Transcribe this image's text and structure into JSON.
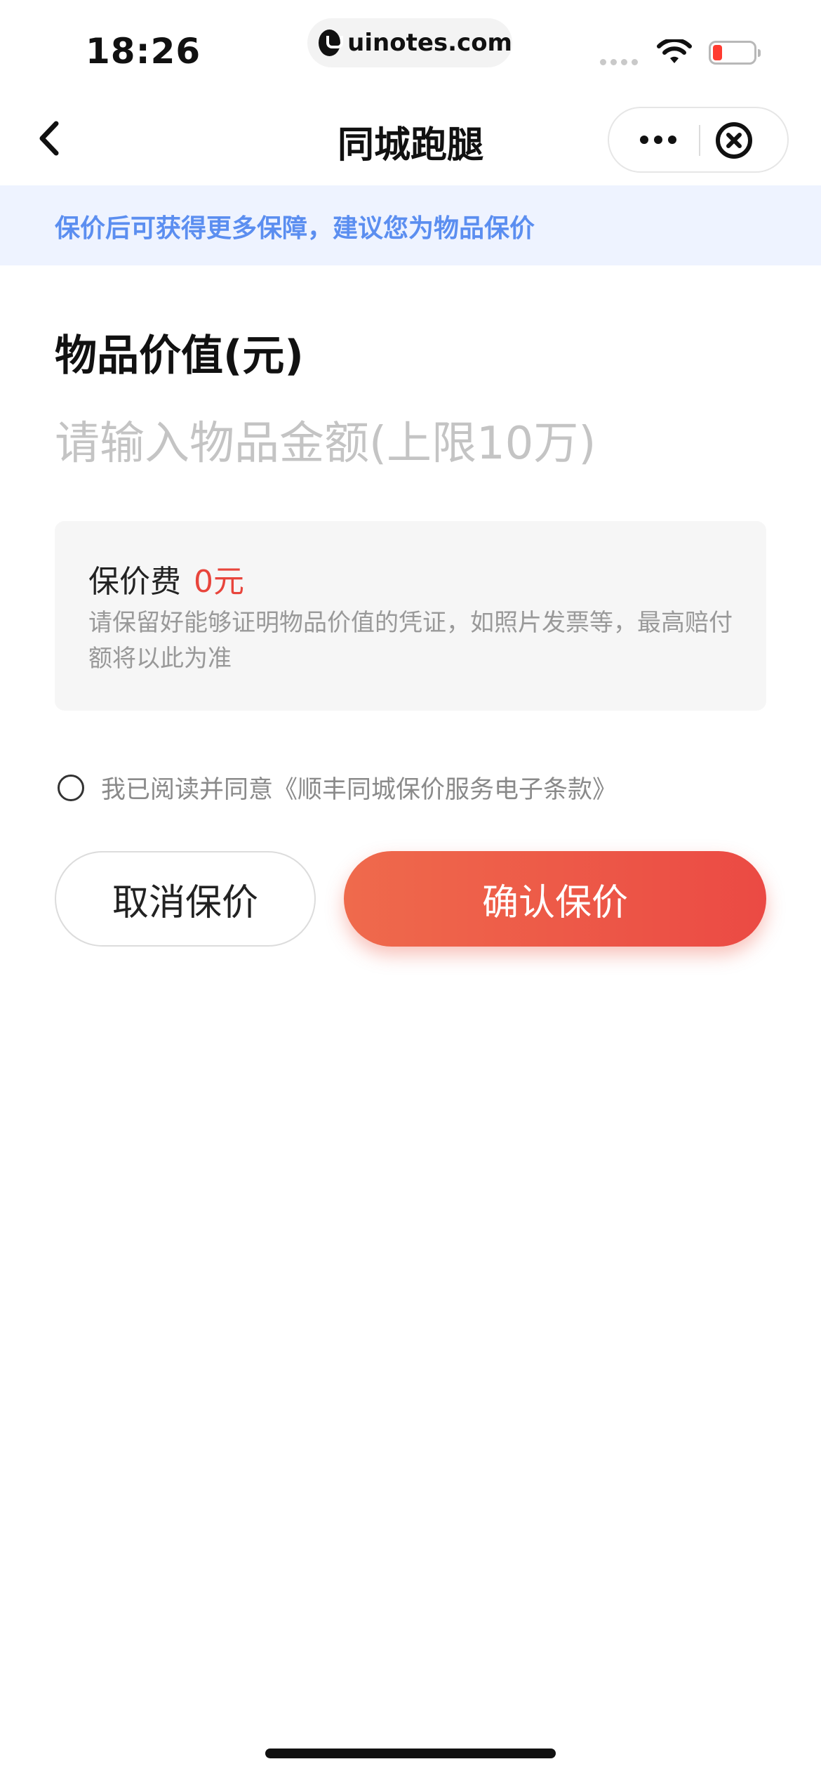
{
  "status_bar": {
    "time": "18:26",
    "url": "uinotes.com"
  },
  "nav": {
    "title": "同城跑腿",
    "back_icon": "chevron-left-icon",
    "more_icon": "more-dots-icon",
    "close_icon": "close-circle-icon"
  },
  "notice": {
    "text": "保价后可获得更多保障，建议您为物品保价"
  },
  "form": {
    "value_title": "物品价值(元)",
    "amount_placeholder": "请输入物品金额(上限10万)",
    "amount_value": "",
    "fee_label": "保价费",
    "fee_value": "0元",
    "fee_desc": "请保留好能够证明物品价值的凭证，如照片发票等，最高赔付额将以此为准",
    "agree_text": "我已阅读并同意《顺丰同城保价服务电子条款》",
    "agree_checked": false
  },
  "buttons": {
    "cancel": "取消保价",
    "confirm": "确认保价"
  },
  "colors": {
    "accent": "#eb4a44",
    "notice_text": "#5b8ef0",
    "notice_bg": "#eef3ff"
  }
}
